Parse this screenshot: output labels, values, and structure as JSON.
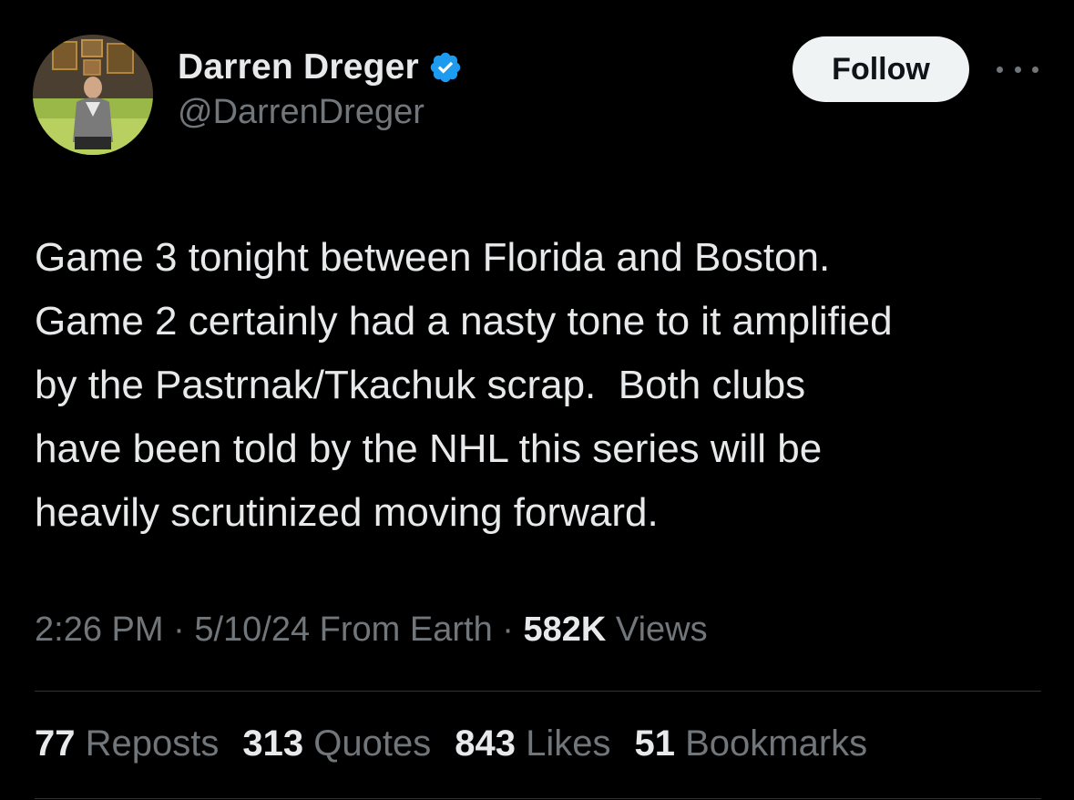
{
  "author": {
    "name": "Darren Dreger",
    "handle": "@DarrenDreger",
    "verified": true,
    "verified_color": "#1d9bf0"
  },
  "follow_button": {
    "label": "Follow"
  },
  "more_menu": {
    "icon": "more-horizontal-icon"
  },
  "tweet": {
    "lines": [
      "Game 3 tonight between Florida and Boston.",
      "Game 2 certainly had a nasty tone to it amplified",
      "by the Pastrnak/Tkachuk scrap.  Both clubs",
      "have been told by the NHL this series will be",
      "heavily scrutinized moving forward."
    ]
  },
  "meta": {
    "time": "2:26 PM",
    "separator": "·",
    "date": "5/10/24",
    "location": "From Earth",
    "views_count": "582K",
    "views_label": "Views"
  },
  "stats": [
    {
      "count": "77",
      "label": "Reposts"
    },
    {
      "count": "313",
      "label": "Quotes"
    },
    {
      "count": "843",
      "label": "Likes"
    },
    {
      "count": "51",
      "label": "Bookmarks"
    }
  ],
  "colors": {
    "background": "#000000",
    "text_primary": "#e7e9ea",
    "text_secondary": "#71767b",
    "divider": "#2f3336",
    "follow_bg": "#eff3f4"
  }
}
